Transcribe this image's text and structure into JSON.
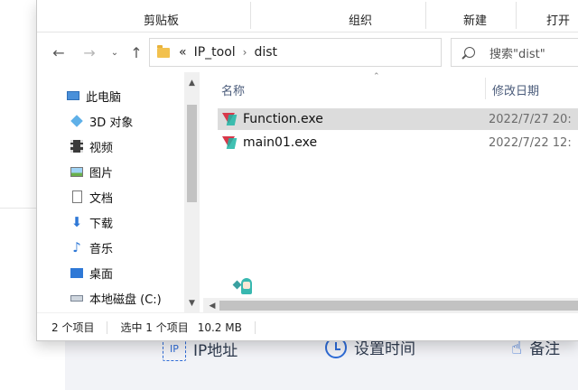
{
  "background_app": {
    "items": [
      {
        "icon_text": "IP",
        "label": "IP地址"
      },
      {
        "label": "设置时间"
      },
      {
        "label": "备注"
      }
    ]
  },
  "ribbon": {
    "groups": [
      "剪贴板",
      "组织",
      "新建",
      "打开"
    ]
  },
  "navbar": {
    "breadcrumb_overflow": "«",
    "breadcrumbs": [
      "IP_tool",
      "dist"
    ],
    "search_placeholder": "搜索\"dist\""
  },
  "sidebar": {
    "items": [
      {
        "label": "此电脑",
        "icon": "pc-icon"
      },
      {
        "label": "3D 对象",
        "icon": "cube-icon"
      },
      {
        "label": "视频",
        "icon": "video-icon"
      },
      {
        "label": "图片",
        "icon": "picture-icon"
      },
      {
        "label": "文档",
        "icon": "document-icon"
      },
      {
        "label": "下载",
        "icon": "download-icon"
      },
      {
        "label": "音乐",
        "icon": "music-icon"
      },
      {
        "label": "桌面",
        "icon": "desktop-icon"
      },
      {
        "label": "本地磁盘 (C:)",
        "icon": "drive-icon"
      }
    ]
  },
  "filelist": {
    "columns": [
      "名称",
      "修改日期"
    ],
    "files": [
      {
        "name": "Function.exe",
        "modified": "2022/7/27 20:",
        "selected": true
      },
      {
        "name": "main01.exe",
        "modified": "2022/7/22 12:",
        "selected": false
      }
    ]
  },
  "status": {
    "count": "2 个项目",
    "selection": "选中 1 个项目",
    "size": "10.2 MB"
  },
  "colors": {
    "accent": "#2e6bd6",
    "selected_row": "#dcdcdc",
    "column_header": "#4a5b7a"
  }
}
